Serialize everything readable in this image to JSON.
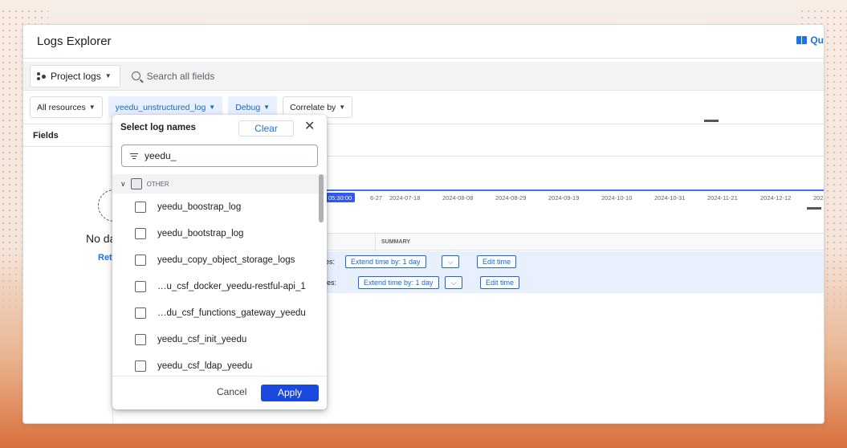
{
  "window": {
    "title": "Logs Explorer",
    "quick_link": "Qu"
  },
  "toolbar": {
    "project_label": "Project logs",
    "search_placeholder": "Search all fields"
  },
  "filters": {
    "resources": "All resources",
    "log_name": "yeedu_unstructured_log",
    "severity": "Debug",
    "correlate": "Correlate by"
  },
  "fields": {
    "header": "Fields",
    "no_data": "No da",
    "retry": "Ret"
  },
  "timeline": {
    "marker": "05:30:00",
    "ticks": [
      "6-27",
      "2024-07-18",
      "2024-08-08",
      "2024-08-29",
      "2024-09-19",
      "2024-10-10",
      "2024-10-31",
      "2024-11-21",
      "2024-12-12",
      "202"
    ]
  },
  "results": {
    "summary_header": "SUMMARY",
    "rows": [
      {
        "label": "es:",
        "extend": "Extend time by: 1 day",
        "split": "⌵",
        "edit": "Edit time"
      },
      {
        "label": "ies:",
        "extend": "Extend time by: 1 day",
        "split": "⌵",
        "edit": "Edit time"
      }
    ]
  },
  "dropdown": {
    "title": "Select log names",
    "clear": "Clear",
    "close": "✕",
    "search_value": "yeedu_",
    "group": "OTHER",
    "items": [
      "yeedu_boostrap_log",
      "yeedu_bootstrap_log",
      "yeedu_copy_object_storage_logs",
      "…u_csf_docker_yeedu-restful-api_1",
      "…du_csf_functions_gateway_yeedu",
      "yeedu_csf_init_yeedu",
      "yeedu_csf_ldap_yeedu"
    ],
    "cancel": "Cancel",
    "apply": "Apply"
  }
}
